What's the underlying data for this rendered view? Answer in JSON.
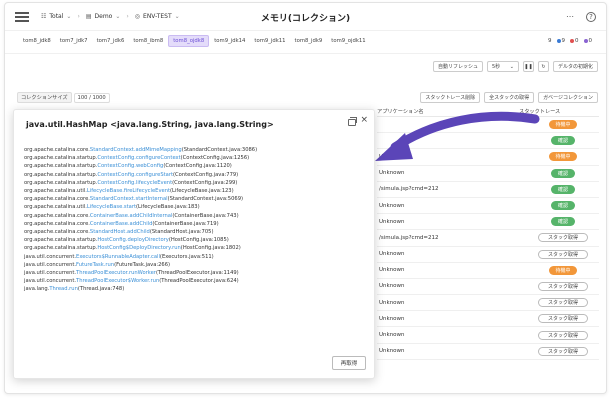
{
  "topbar": {
    "crumbs": [
      {
        "icon": "database-icon",
        "label": "Total"
      },
      {
        "icon": "server-icon",
        "label": "Demo"
      },
      {
        "icon": "node-icon",
        "label": "ENV-TEST"
      }
    ],
    "title": "メモリ(コレクション)",
    "more": "⋯",
    "help": "?"
  },
  "tabs": [
    "tom8_jdk8",
    "tom7_jdk7",
    "tom7_jdk6",
    "tom8_ibm8",
    "tom8_ojdk8",
    "tom9_jdk14",
    "tom9_jdk11",
    "tom8_jdk9",
    "tom9_ojdk11"
  ],
  "active_tab": 4,
  "counts": {
    "total": "9",
    "blue": "9",
    "red": "0",
    "purple": "0",
    "colors": {
      "blue": "#3a7bd5",
      "red": "#e05050",
      "purple": "#8a63d2"
    }
  },
  "controls": {
    "auto_refresh": "自動リフレッシュ",
    "interval": "5秒",
    "pause_icon": "pause-icon",
    "refresh_icon": "refresh-icon",
    "reset_delta": "デルタの初期化"
  },
  "collection": {
    "label": "コレクションサイズ",
    "value": "100 / 1000"
  },
  "actions": {
    "delete_traces": "スタックトレース削除",
    "get_all": "全スタックの取得",
    "gc": "ガベージコレクション"
  },
  "table": {
    "headers": [
      "アプリケーション名",
      "スタックトレース"
    ],
    "rows": [
      {
        "app": "",
        "status": "待機中",
        "kind": "waiting"
      },
      {
        "app": "",
        "status": "確認",
        "kind": "confirm"
      },
      {
        "app": "Unknown",
        "status": "待機中",
        "kind": "waiting"
      },
      {
        "app": "Unknown",
        "status": "確認",
        "kind": "confirm"
      },
      {
        "app": "/simula.jsp?cmd=212",
        "status": "確認",
        "kind": "confirm"
      },
      {
        "app": "Unknown",
        "status": "確認",
        "kind": "confirm"
      },
      {
        "app": "Unknown",
        "status": "確認",
        "kind": "confirm"
      },
      {
        "app": "/simula.jsp?cmd=212",
        "status": "スタック取得",
        "kind": "fetch"
      },
      {
        "app": "Unknown",
        "status": "スタック取得",
        "kind": "fetch"
      },
      {
        "app": "Unknown",
        "status": "待機中",
        "kind": "waiting"
      },
      {
        "app": "Unknown",
        "status": "スタック取得",
        "kind": "fetch"
      },
      {
        "app": "Unknown",
        "status": "スタック取得",
        "kind": "fetch"
      },
      {
        "app": "Unknown",
        "status": "スタック取得",
        "kind": "fetch"
      },
      {
        "app": "Unknown",
        "status": "スタック取得",
        "kind": "fetch"
      },
      {
        "app": "Unknown",
        "status": "スタック取得",
        "kind": "fetch"
      }
    ]
  },
  "modal": {
    "title": "java.util.HashMap <java.lang.String, java.lang.String>",
    "refetch": "再取得",
    "trace": [
      {
        "pre": "org.apache.catalina.core.",
        "m": "StandardContext.addMimeMapping",
        "post": "(StandardContext.java:3086)"
      },
      {
        "pre": "org.apache.catalina.startup.",
        "m": "ContextConfig.configureContext",
        "post": "(ContextConfig.java:1256)"
      },
      {
        "pre": "org.apache.catalina.startup.",
        "m": "ContextConfig.webConfig",
        "post": "(ContextConfig.java:1120)"
      },
      {
        "pre": "org.apache.catalina.startup.",
        "m": "ContextConfig.configureStart",
        "post": "(ContextConfig.java:779)"
      },
      {
        "pre": "org.apache.catalina.startup.",
        "m": "ContextConfig.lifecycleEvent",
        "post": "(ContextConfig.java:299)"
      },
      {
        "pre": "org.apache.catalina.util.",
        "m": "LifecycleBase.fireLifecycleEvent",
        "post": "(LifecycleBase.java:123)"
      },
      {
        "pre": "org.apache.catalina.core.",
        "m": "StandardContext.startInternal",
        "post": "(StandardContext.java:5069)"
      },
      {
        "pre": "org.apache.catalina.util.",
        "m": "LifecycleBase.start",
        "post": "(LifecycleBase.java:183)"
      },
      {
        "pre": "org.apache.catalina.core.",
        "m": "ContainerBase.addChildInternal",
        "post": "(ContainerBase.java:743)"
      },
      {
        "pre": "org.apache.catalina.core.",
        "m": "ContainerBase.addChild",
        "post": "(ContainerBase.java:719)"
      },
      {
        "pre": "org.apache.catalina.core.",
        "m": "StandardHost.addChild",
        "post": "(StandardHost.java:705)"
      },
      {
        "pre": "org.apache.catalina.startup.",
        "m": "HostConfig.deployDirectory",
        "post": "(HostConfig.java:1085)"
      },
      {
        "pre": "org.apache.catalina.startup.",
        "m": "HostConfig$DeployDirectory.run",
        "post": "(HostConfig.java:1802)"
      },
      {
        "pre": "java.util.concurrent.",
        "m": "Executors$RunnableAdapter.call",
        "post": "(Executors.java:511)"
      },
      {
        "pre": "java.util.concurrent.",
        "m": "FutureTask.run",
        "post": "(FutureTask.java:266)"
      },
      {
        "pre": "java.util.concurrent.",
        "m": "ThreadPoolExecutor.runWorker",
        "post": "(ThreadPoolExecutor.java:1149)"
      },
      {
        "pre": "java.util.concurrent.",
        "m": "ThreadPoolExecutor$Worker.run",
        "post": "(ThreadPoolExecutor.java:624)"
      },
      {
        "pre": "java.lang.",
        "m": "Thread.run",
        "post": "(Thread.java:748)"
      }
    ]
  },
  "colors": {
    "accent": "#6b4dd6",
    "waiting": "#f2973a",
    "confirm": "#56b46a",
    "link": "#3a8fd6",
    "arrow": "#5b45b8"
  }
}
